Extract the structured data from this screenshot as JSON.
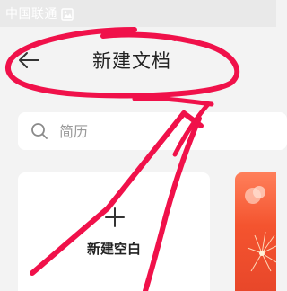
{
  "status_bar": {
    "carrier": "中国联通",
    "gallery_icon": "gallery-icon"
  },
  "header": {
    "back_icon": "back-arrow-icon",
    "title": "新建文档"
  },
  "search": {
    "placeholder": "简历",
    "icon": "search-icon"
  },
  "new_blank": {
    "icon": "plus-icon",
    "label": "新建空白"
  },
  "colors": {
    "annotation": "#f0114a",
    "template_card": "#f4542f"
  }
}
